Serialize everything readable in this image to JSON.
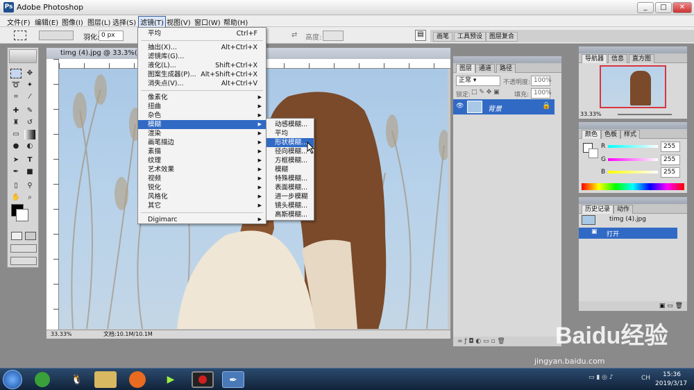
{
  "app": {
    "title": "Adobe Photoshop",
    "logo_text": "Ps",
    "win_min": "_",
    "win_restore": "□",
    "win_close": "✕"
  },
  "menubar": {
    "items": [
      "文件(F)",
      "编辑(E)",
      "图像(I)",
      "图层(L)",
      "选择(S)",
      "滤镜(T)",
      "视图(V)",
      "窗口(W)",
      "帮助(H)"
    ]
  },
  "options": {
    "feather_label": "羽化:",
    "feather_value": "0 px",
    "height_label": "高度:",
    "tabs": [
      "画笔",
      "工具预设",
      "图层复合"
    ]
  },
  "document": {
    "title": "timg (4).jpg @ 33.3%(RGB/",
    "zoom": "33.33%",
    "doc_info": "文档:10.1M/10.1M"
  },
  "filter_menu": {
    "items": [
      {
        "label": "平均",
        "shortcut": "Ctrl+F"
      },
      {
        "sep": true
      },
      {
        "label": "抽出(X)...",
        "shortcut": "Alt+Ctrl+X"
      },
      {
        "label": "滤镜库(G)...",
        "shortcut": ""
      },
      {
        "label": "液化(L)...",
        "shortcut": "Shift+Ctrl+X"
      },
      {
        "label": "图案生成器(P)...",
        "shortcut": "Alt+Shift+Ctrl+X"
      },
      {
        "label": "消失点(V)...",
        "shortcut": "Alt+Ctrl+V"
      },
      {
        "sep": true
      },
      {
        "label": "像素化",
        "sub": true
      },
      {
        "label": "扭曲",
        "sub": true
      },
      {
        "label": "杂色",
        "sub": true
      },
      {
        "label": "模糊",
        "sub": true,
        "selected": true
      },
      {
        "label": "渲染",
        "sub": true
      },
      {
        "label": "画笔描边",
        "sub": true
      },
      {
        "label": "素描",
        "sub": true
      },
      {
        "label": "纹理",
        "sub": true
      },
      {
        "label": "艺术效果",
        "sub": true
      },
      {
        "label": "视频",
        "sub": true
      },
      {
        "label": "锐化",
        "sub": true
      },
      {
        "label": "风格化",
        "sub": true
      },
      {
        "label": "其它",
        "sub": true
      },
      {
        "sep": true
      },
      {
        "label": "Digimarc",
        "sub": true
      }
    ]
  },
  "blur_submenu": {
    "items": [
      {
        "label": "动感模糊..."
      },
      {
        "label": "平均"
      },
      {
        "label": "形状模糊...",
        "selected": true
      },
      {
        "label": "径向模糊..."
      },
      {
        "label": "方框模糊..."
      },
      {
        "label": "模糊"
      },
      {
        "label": "特殊模糊..."
      },
      {
        "label": "表面模糊..."
      },
      {
        "label": "进一步模糊"
      },
      {
        "label": "镜头模糊..."
      },
      {
        "label": "高斯模糊..."
      }
    ]
  },
  "layers_panel": {
    "tabs": [
      "图层",
      "通道",
      "路径"
    ],
    "blend_mode": "正常",
    "opacity_label": "不透明度:",
    "opacity_value": "100%",
    "lock_label": "锁定:",
    "fill_label": "填充:",
    "fill_value": "100%",
    "layer_name": "背景"
  },
  "navigator_panel": {
    "tabs": [
      "导航器",
      "信息",
      "直方图"
    ],
    "zoom": "33.33%"
  },
  "color_panel": {
    "tabs": [
      "颜色",
      "色板",
      "样式"
    ],
    "r_label": "R",
    "g_label": "G",
    "b_label": "B",
    "r": "255",
    "g": "255",
    "b": "255"
  },
  "history_panel": {
    "tabs": [
      "历史记录",
      "动作"
    ],
    "snapshot": "timg (4).jpg",
    "state": "打开"
  },
  "watermark": {
    "brand": "Baidu经验",
    "url": "jingyan.baidu.com"
  },
  "taskbar": {
    "time": "15:36",
    "date": "2019/3/17",
    "lang": "CH"
  },
  "icons": [
    "move-icon",
    "marquee-icon",
    "lasso-icon",
    "magic-wand-icon",
    "crop-icon",
    "slice-icon",
    "healing-icon",
    "brush-icon",
    "stamp-icon",
    "history-brush-icon",
    "eraser-icon",
    "gradient-icon",
    "blur-icon",
    "dodge-icon",
    "path-select-icon",
    "type-icon",
    "pen-icon",
    "shape-icon",
    "notes-icon",
    "eyedropper-icon",
    "hand-icon",
    "zoom-icon"
  ]
}
